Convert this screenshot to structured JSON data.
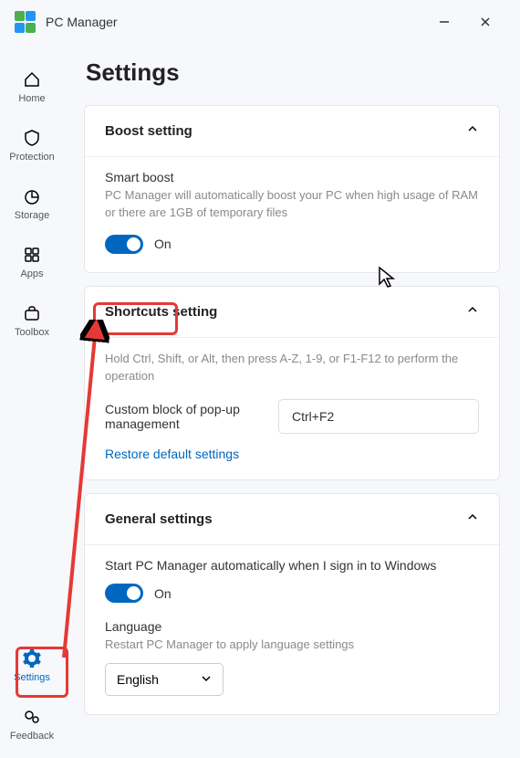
{
  "app": {
    "title": "PC Manager"
  },
  "sidebar": {
    "items": [
      {
        "label": "Home"
      },
      {
        "label": "Protection"
      },
      {
        "label": "Storage"
      },
      {
        "label": "Apps"
      },
      {
        "label": "Toolbox"
      }
    ],
    "footer": [
      {
        "label": "Settings"
      },
      {
        "label": "Feedback"
      }
    ]
  },
  "page": {
    "title": "Settings",
    "boost": {
      "title": "Boost setting",
      "smart_title": "Smart boost",
      "smart_desc": "PC Manager will automatically boost your PC when high usage of RAM or there are 1GB of temporary files",
      "toggle_state": "On"
    },
    "shortcuts": {
      "title": "Shortcuts setting",
      "desc": "Hold Ctrl, Shift, or Alt, then press A-Z, 1-9, or F1-F12 to perform the operation",
      "field_label": "Custom block of pop-up management",
      "field_value": "Ctrl+F2",
      "restore": "Restore default settings"
    },
    "general": {
      "title": "General settings",
      "autostart": "Start PC Manager automatically when I sign in to Windows",
      "autostart_state": "On",
      "language_label": "Language",
      "language_desc": "Restart PC Manager to apply language settings",
      "language_value": "English"
    }
  }
}
